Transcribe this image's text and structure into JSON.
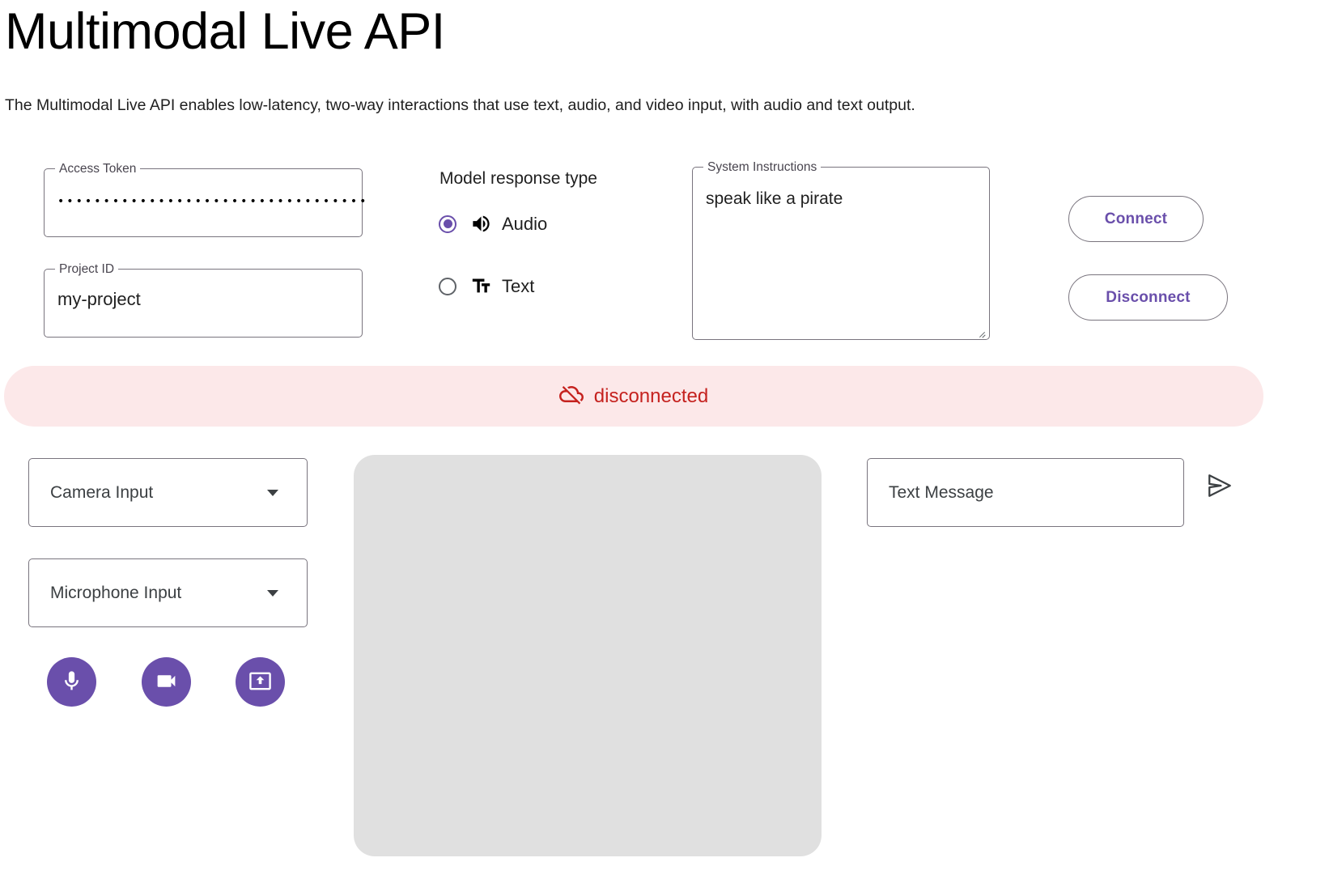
{
  "header": {
    "title": "Multimodal Live API",
    "subtitle": "The Multimodal Live API enables low-latency, two-way interactions that use text, audio, and video input, with audio and text output."
  },
  "form": {
    "access_token": {
      "label": "Access Token",
      "value": "••••••••••••••••••••••••••••••••••",
      "masked": true
    },
    "project_id": {
      "label": "Project ID",
      "value": "my-project",
      "placeholder": "Project ID"
    },
    "system_instructions": {
      "label": "System Instructions",
      "value": "speak like a pirate",
      "placeholder": "System Instructions"
    }
  },
  "response_type": {
    "title": "Model response type",
    "selected": "Audio",
    "options": [
      {
        "label": "Audio",
        "icon": "volume-up-icon",
        "selected": true
      },
      {
        "label": "Text",
        "icon": "format-size-icon",
        "selected": false
      }
    ]
  },
  "connection": {
    "connect_label": "Connect",
    "disconnect_label": "Disconnect",
    "accent_color": "#6a4fab"
  },
  "status": {
    "text": "disconnected",
    "icon": "cloud-off-icon",
    "text_color": "#c5221f",
    "background_color": "#fce8e9"
  },
  "inputs": {
    "camera": {
      "label": "Camera Input",
      "selected": "Camera Input"
    },
    "microphone": {
      "label": "Microphone Input",
      "selected": "Microphone Input"
    }
  },
  "media_controls": [
    {
      "name": "mic-button",
      "icon": "mic-icon"
    },
    {
      "name": "video-button",
      "icon": "videocam-icon"
    },
    {
      "name": "present-button",
      "icon": "present-to-all-icon"
    }
  ],
  "message": {
    "placeholder": "Text Message",
    "value": "",
    "send_icon": "send-icon"
  }
}
